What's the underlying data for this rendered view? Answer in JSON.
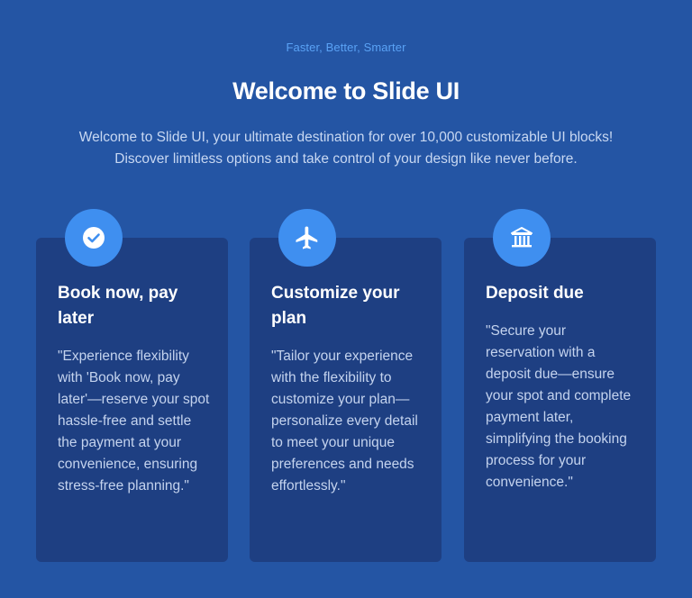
{
  "hero": {
    "eyebrow": "Faster, Better, Smarter",
    "title": "Welcome to Slide UI",
    "intro": "Welcome to Slide UI, your ultimate destination for over 10,000 customizable UI blocks! Discover limitless options and take control of your design like never before."
  },
  "colors": {
    "background": "#2455a4",
    "card": "#1e3f82",
    "accent": "#3f8ff0",
    "eyebrow": "#5aa2f5"
  },
  "features": [
    {
      "icon": "check-circle-icon",
      "title": "Book now, pay later",
      "body": "\"Experience flexibility with 'Book now, pay later'—reserve your spot hassle-free and settle the payment at your convenience, ensuring stress-free planning.\""
    },
    {
      "icon": "airplane-icon",
      "title": "Customize your plan",
      "body": "\"Tailor your experience with the flexibility to customize your plan—personalize every detail to meet your unique preferences and needs effortlessly.\""
    },
    {
      "icon": "bank-icon",
      "title": "Deposit due",
      "body": "\"Secure your reservation with a deposit due—ensure your spot and complete payment later, simplifying the booking process for your convenience.\""
    }
  ]
}
